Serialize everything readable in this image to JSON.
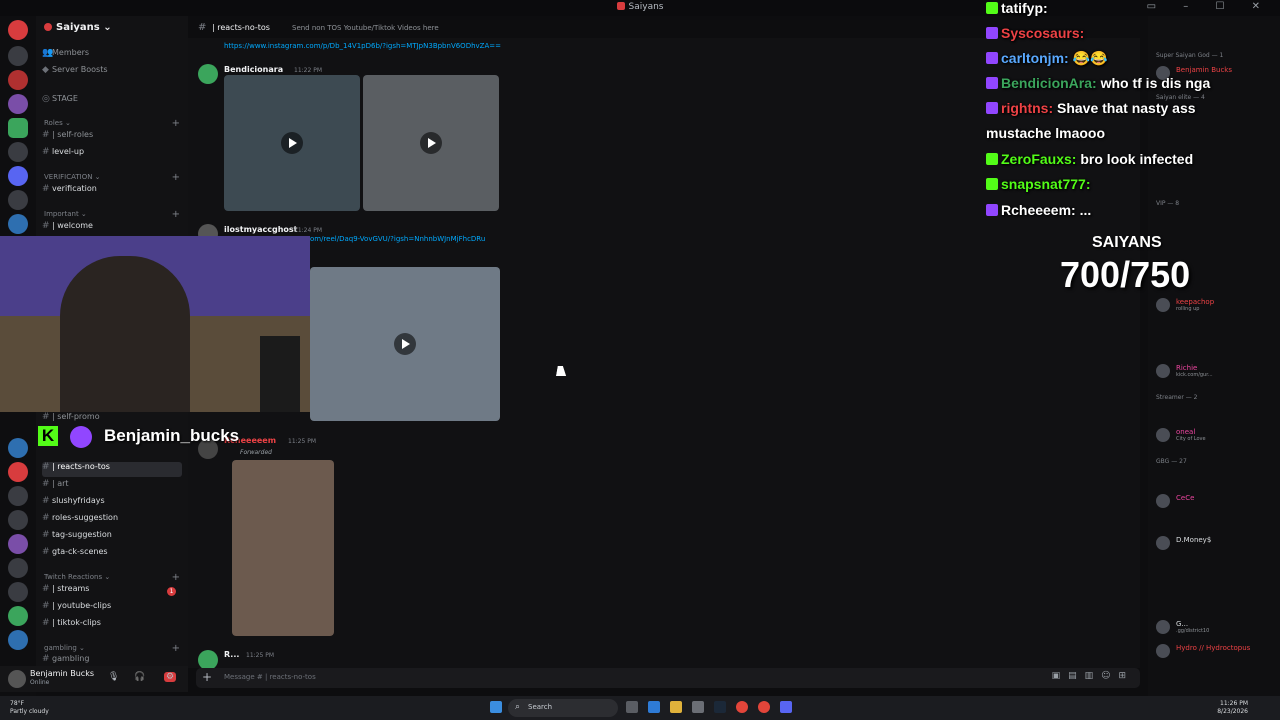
{
  "window": {
    "title": "Saiyans"
  },
  "sidebar": {
    "server_name": "Saiyans",
    "top_items": [
      {
        "label": "Members"
      },
      {
        "label": "Server Boosts"
      },
      {
        "label": "STAGE"
      }
    ],
    "categories": [
      {
        "label": "Roles"
      },
      {
        "label": "VERIFICATION"
      },
      {
        "label": "Important"
      },
      {
        "label": "Twitch Reactions"
      },
      {
        "label": "gambling"
      }
    ],
    "channels": [
      {
        "label": "| self-roles"
      },
      {
        "label": "level-up"
      },
      {
        "label": "verification"
      },
      {
        "label": "| welcome"
      },
      {
        "label": "| self-promo"
      },
      {
        "label": "| reacts-no-tos"
      },
      {
        "label": "| art"
      },
      {
        "label": "slushyfridays"
      },
      {
        "label": "roles-suggestion"
      },
      {
        "label": "tag-suggestion"
      },
      {
        "label": "gta-ck-scenes"
      },
      {
        "label": "| streams",
        "badge": "1"
      },
      {
        "label": "| youtube-clips"
      },
      {
        "label": "| tiktok-clips"
      },
      {
        "label": "gambling"
      }
    ]
  },
  "user_panel": {
    "name": "Benjamin Bucks",
    "status": "Online"
  },
  "channel_header": {
    "name": "| reacts-no-tos",
    "topic": "Send non TOS Youtube/Tiktok Videos here"
  },
  "messages": [
    {
      "link": "https://www.instagram.com/p/Db_14V1pD6b/?igsh=MTJpN3BpbnV6ODhvZA=="
    },
    {
      "author": "Bendicionara",
      "time": "11:22 PM"
    },
    {
      "author": "ilostmyaccghost",
      "time": "11:24 PM",
      "link": "om/reel/Daq9-VovGVU/?igsh=NnhnbWJnMjFhcDRu"
    },
    {
      "author": "Rcheeeeem",
      "time": "11:25 PM",
      "forwarded": "Forwarded"
    },
    {
      "author": "R...",
      "time": "11:25 PM"
    }
  ],
  "composer": {
    "placeholder": "Message # | reacts-no-tos"
  },
  "members": {
    "groups": [
      {
        "label": "Super Saiyan God — 1"
      },
      {
        "label": "Saiyan elite — 4"
      },
      {
        "label": "VIP — 8"
      },
      {
        "label": "Streamer — 2"
      },
      {
        "label": "GBG — 27"
      }
    ],
    "rows": [
      {
        "name": "Benjamin Bucks",
        "sub": "",
        "color": "#ed4245"
      },
      {
        "name": "keepachop",
        "sub": "rolling up",
        "color": "#ed4245"
      },
      {
        "name": "Richie",
        "sub": "kick.com/gur...",
        "color": "#eb459e"
      },
      {
        "name": "oneal",
        "sub": "City of Love",
        "color": "#eb459e"
      },
      {
        "name": "CeCe",
        "sub": "",
        "color": "#eb459e"
      },
      {
        "name": "D.Money$",
        "sub": "",
        "color": "#dbdee1"
      },
      {
        "name": "G...",
        "sub": ".gg/district10",
        "color": "#dbdee1"
      },
      {
        "name": "Hydro // Hydroctopus",
        "sub": "",
        "color": "#ed4245"
      }
    ]
  },
  "overlay": {
    "chat": [
      {
        "user": "tatifyp:",
        "text": "",
        "user_color": "#ffffff",
        "badge": "#53fc18"
      },
      {
        "user": "Syscosaurs:",
        "text": "",
        "user_color": "#ed4245",
        "badge": "#9146ff"
      },
      {
        "user": "carltonjm:",
        "text": "😂😂",
        "user_color": "#5aa9ff",
        "badge": "#9146ff"
      },
      {
        "user": "BendicionAra:",
        "text": "who tf is dis nga",
        "user_color": "#3ba55c",
        "badge": "#9146ff"
      },
      {
        "user": "rightns:",
        "text": "Shave that nasty ass",
        "user_color": "#ed4245",
        "badge": "#9146ff"
      },
      {
        "user": "",
        "text": "mustache lmaooo",
        "user_color": "#ffffff",
        "badge": ""
      },
      {
        "user": "ZeroFauxs:",
        "text": "bro look infected",
        "user_color": "#53fc18",
        "badge": "#53fc18"
      },
      {
        "user": "snapsnat777:",
        "text": "",
        "user_color": "#53fc18",
        "badge": "#53fc18"
      },
      {
        "user": "Rcheeeem:",
        "text": "...",
        "user_color": "#ffffff",
        "badge": "#9146ff"
      }
    ],
    "goal_label": "SAIYANS",
    "goal_value": "700/750",
    "streamer_handle": "Benjamin_bucks"
  },
  "taskbar": {
    "weather_temp": "78°F",
    "weather_desc": "Partly cloudy",
    "search_label": "Search",
    "time": "11:26 PM",
    "date": "8/23/2026"
  }
}
